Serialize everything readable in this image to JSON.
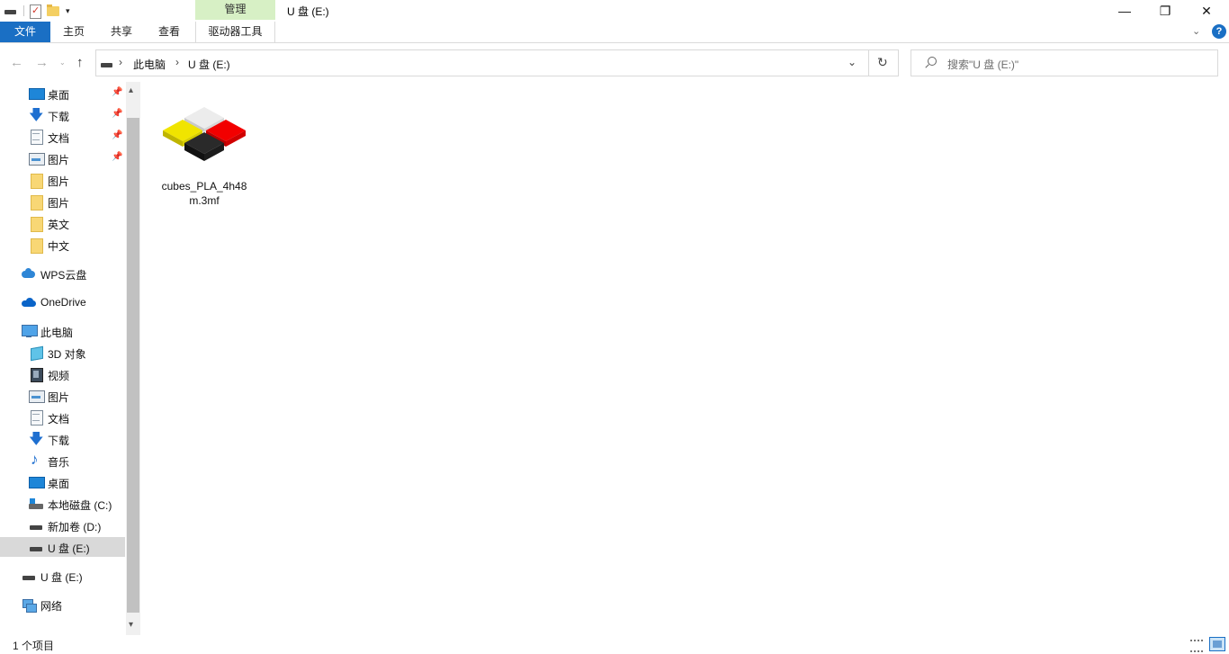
{
  "window": {
    "title": "U 盘 (E:)",
    "manage_tab": "管理",
    "min_glyph": "—",
    "max_glyph": "❐",
    "close_glyph": "✕"
  },
  "qat": {
    "dropdown_glyph": "▾"
  },
  "ribbon": {
    "tabs": {
      "file": "文件",
      "home": "主页",
      "share": "共享",
      "view": "查看",
      "drive_tools": "驱动器工具"
    },
    "collapse_glyph": "⌄",
    "help_glyph": "?",
    "accent_color": "#1a6fc4",
    "manage_tab_color": "#d7f0c5"
  },
  "nav": {
    "back_glyph": "←",
    "forward_glyph": "→",
    "recent_glyph": "⌄",
    "up_glyph": "↑"
  },
  "address": {
    "sep1": "›",
    "segment1": "此电脑",
    "sep2": "›",
    "segment2": "U 盘 (E:)",
    "dropdown_glyph": "⌄",
    "refresh_glyph": "↻"
  },
  "search": {
    "placeholder": "搜索\"U 盘 (E:)\""
  },
  "navpane": {
    "quick_access": [
      {
        "label": "桌面",
        "icon": "desktop-icon",
        "pinned": true
      },
      {
        "label": "下载",
        "icon": "download-icon",
        "pinned": true
      },
      {
        "label": "文档",
        "icon": "document-icon",
        "pinned": true
      },
      {
        "label": "图片",
        "icon": "pictures-icon",
        "pinned": true
      },
      {
        "label": "图片",
        "icon": "folder-icon",
        "pinned": false
      },
      {
        "label": "图片",
        "icon": "folder-icon",
        "pinned": false
      },
      {
        "label": "英文",
        "icon": "folder-icon",
        "pinned": false
      },
      {
        "label": "中文",
        "icon": "folder-icon",
        "pinned": false
      }
    ],
    "pin_glyph": "📌",
    "wps_cloud": "WPS云盘",
    "onedrive": "OneDrive",
    "this_pc": "此电脑",
    "this_pc_items": [
      {
        "label": "3D 对象",
        "icon": "3d-objects-icon"
      },
      {
        "label": "视频",
        "icon": "video-icon"
      },
      {
        "label": "图片",
        "icon": "pictures-icon"
      },
      {
        "label": "文档",
        "icon": "document-icon"
      },
      {
        "label": "下载",
        "icon": "download-icon"
      },
      {
        "label": "音乐",
        "icon": "music-icon"
      },
      {
        "label": "桌面",
        "icon": "desktop-icon"
      },
      {
        "label": "本地磁盘 (C:)",
        "icon": "system-drive-icon"
      },
      {
        "label": "新加卷 (D:)",
        "icon": "drive-icon"
      },
      {
        "label": "U 盘 (E:)",
        "icon": "usb-drive-icon",
        "selected": true
      }
    ],
    "usb_drive": "U 盘 (E:)",
    "network": "网络",
    "scroll_up_glyph": "▴",
    "scroll_down_glyph": "▾"
  },
  "files": [
    {
      "name": "cubes_PLA_4h48m.3mf",
      "icon": "3mf-cubes-icon"
    }
  ],
  "status": {
    "item_count": "1 个项目"
  }
}
